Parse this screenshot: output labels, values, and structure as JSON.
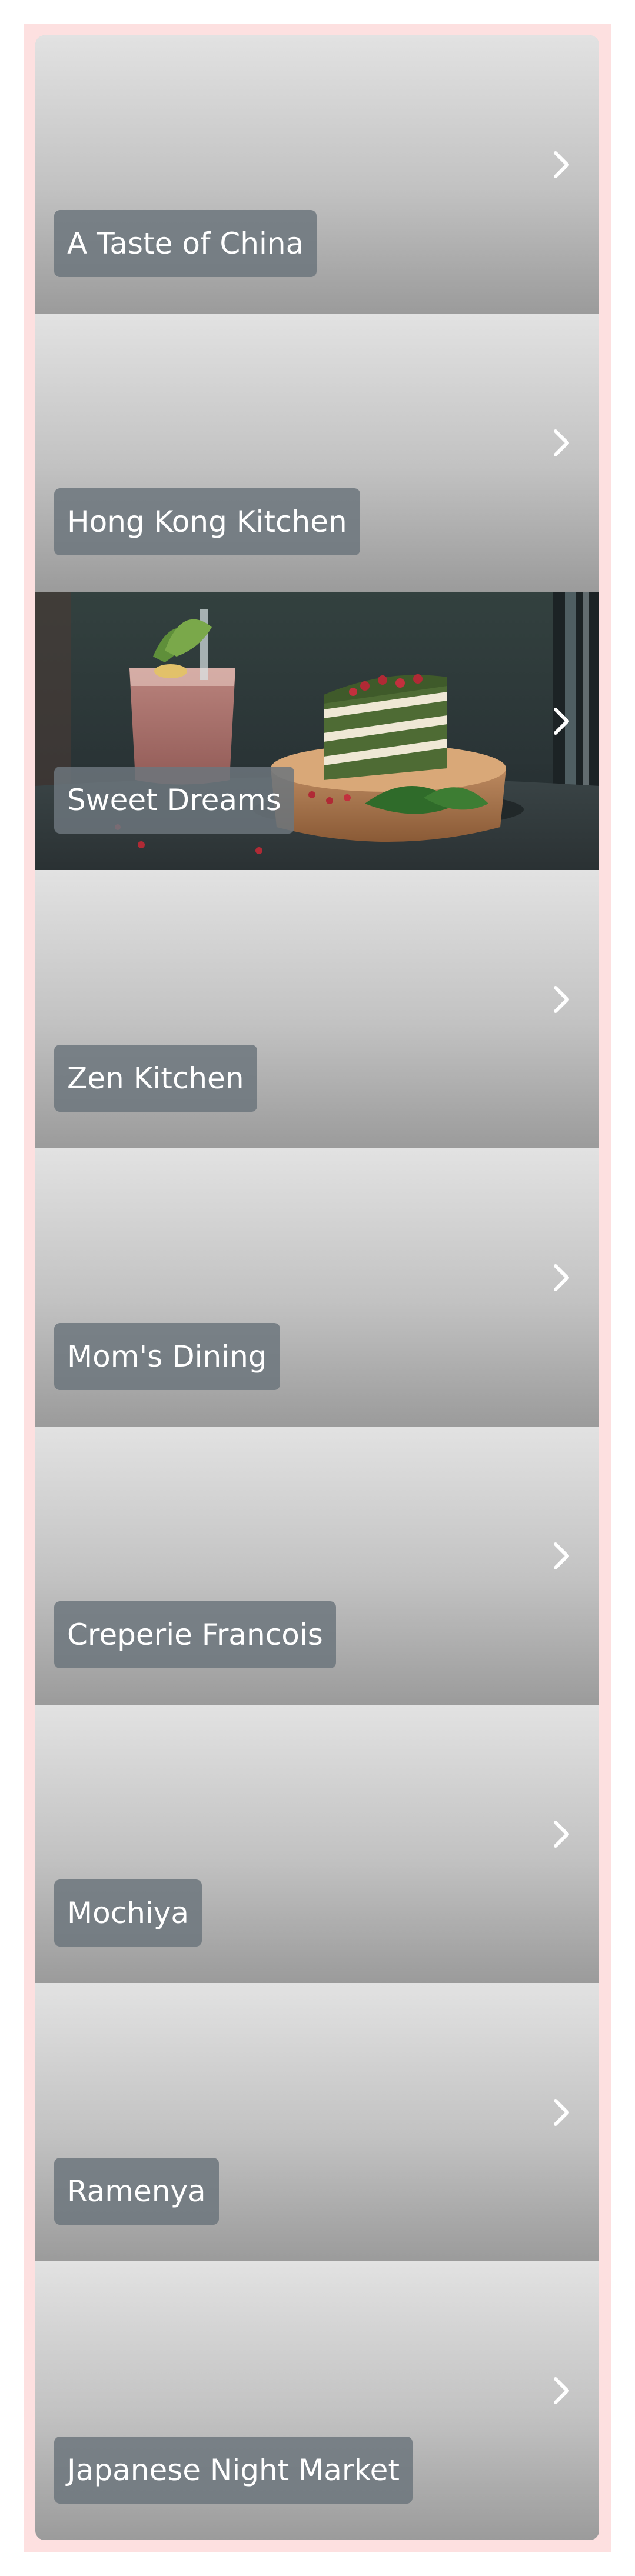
{
  "restaurants": [
    {
      "name": "A Taste of China",
      "has_photo": false
    },
    {
      "name": "Hong Kong Kitchen",
      "has_photo": false
    },
    {
      "name": "Sweet Dreams",
      "has_photo": true
    },
    {
      "name": "Zen Kitchen",
      "has_photo": false
    },
    {
      "name": "Mom's Dining",
      "has_photo": false
    },
    {
      "name": "Creperie Francois",
      "has_photo": false
    },
    {
      "name": "Mochiya",
      "has_photo": false
    },
    {
      "name": "Ramenya",
      "has_photo": false
    },
    {
      "name": "Japanese Night Market",
      "has_photo": false
    }
  ],
  "icons": {
    "chevron": "chevron-right-icon"
  },
  "colors": {
    "frame_background": "#fde0e0",
    "label_background": "#6c757d",
    "label_text": "#ffffff"
  }
}
